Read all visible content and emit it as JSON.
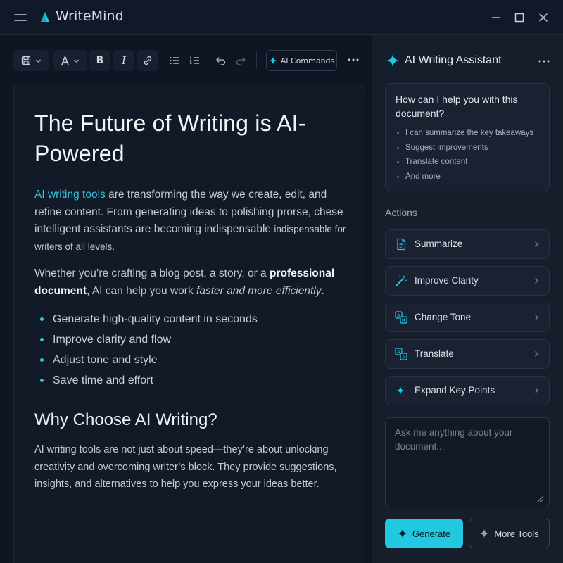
{
  "app": {
    "title": "WriteMind",
    "accent_color": "#22c7e0"
  },
  "window_controls": [
    "minimize-icon",
    "maximize-icon",
    "close-icon"
  ],
  "toolbar": {
    "ai_commands_label": "AI Commands",
    "icons": [
      "save-icon",
      "font-icon",
      "bold-icon",
      "italic-icon",
      "link-icon",
      "bullet-list-icon",
      "numbered-list-icon",
      "undo-icon",
      "redo-icon",
      "more-icon"
    ],
    "font_glyph": "A",
    "bold_glyph": "B",
    "italic_glyph": "I"
  },
  "document": {
    "title": "The Future of Writing is AI-Powered",
    "p1_link": "AI writing tools",
    "p1_text": " are transforming the way we create, edit, and refine content. From generating ideas to polishing prorse, chese intelligent assistants are becoming indispensable",
    "p1_small": "indispensable for writers of all levels.",
    "p2_before": "Whether you’re crafting a blog post, a story, or a ",
    "p2_strong": "professional document",
    "p2_middle": ", AI can help you work ",
    "p2_em": "faster and more efficiently",
    "p2_end": ".",
    "bullets": [
      "Generate high-quality content in seconds",
      "Improve clarity and flow",
      "Adjust tone and style",
      "Save time and effort"
    ],
    "subheading": "Why Choose AI Writing?",
    "p3": "AI writing tools are not just about speed—they’re about unlocking creativity and overcoming writer’s block. They provide suggestions, insights, and alternatives to help you express your ideas better."
  },
  "assistant": {
    "title": "AI Writing Assistant",
    "help_question": "How can I help you with this document?",
    "help_items": [
      "I can summarize the key takeaways",
      "Suggest improvements",
      "Translate content",
      "And more"
    ],
    "actions_label": "Actions",
    "actions": [
      {
        "label": "Summarize",
        "icon": "document-icon"
      },
      {
        "label": "Improve Clarity",
        "icon": "magic-wand-icon"
      },
      {
        "label": "Change Tone",
        "icon": "tone-icon"
      },
      {
        "label": "Translate",
        "icon": "translate-icon"
      },
      {
        "label": "Expand Key Points",
        "icon": "sparkle-icon"
      }
    ],
    "input_placeholder": "Ask me anything about your document...",
    "generate_label": "Generate",
    "more_tools_label": "More Tools"
  }
}
